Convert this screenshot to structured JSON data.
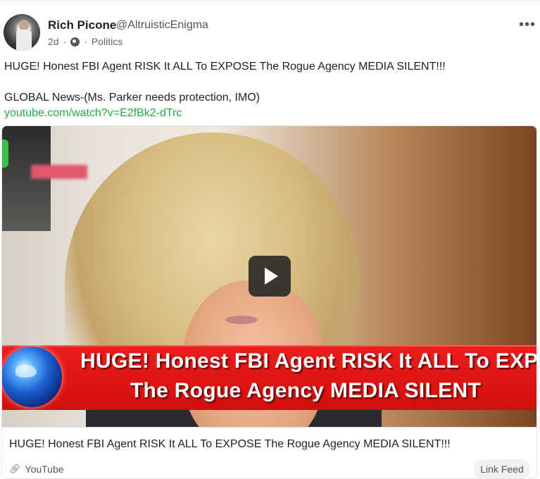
{
  "post": {
    "author": {
      "name": "Rich Picone",
      "handle": "@AltruisticEnigma"
    },
    "meta": {
      "age": "2d",
      "separator1": "·",
      "separator2": "·",
      "category": "Politics"
    },
    "text_line1": "HUGE! Honest FBI Agent RISK It ALL To EXPOSE The Rogue Agency MEDIA SILENT!!!",
    "text_line2": "GLOBAL News-(Ms. Parker needs protection, IMO)",
    "link": "youtube.com/watch?v=E2fBk2-dTrc",
    "more_menu": "•••"
  },
  "preview": {
    "banner_line1": "HUGE! Honest FBI Agent RISK It ALL To EXPOSE",
    "banner_line2": "The Rogue Agency MEDIA SILENT",
    "title": "HUGE! Honest FBI Agent RISK It ALL To EXPOSE The Rogue Agency MEDIA SILENT!!!",
    "source": "YouTube",
    "feed_button": "Link Feed"
  },
  "icons": {
    "visibility": "globe-icon",
    "more": "more-options-icon",
    "play": "play-icon",
    "link": "link-icon"
  },
  "colors": {
    "link": "#2aa84a",
    "banner": "#e21616"
  }
}
